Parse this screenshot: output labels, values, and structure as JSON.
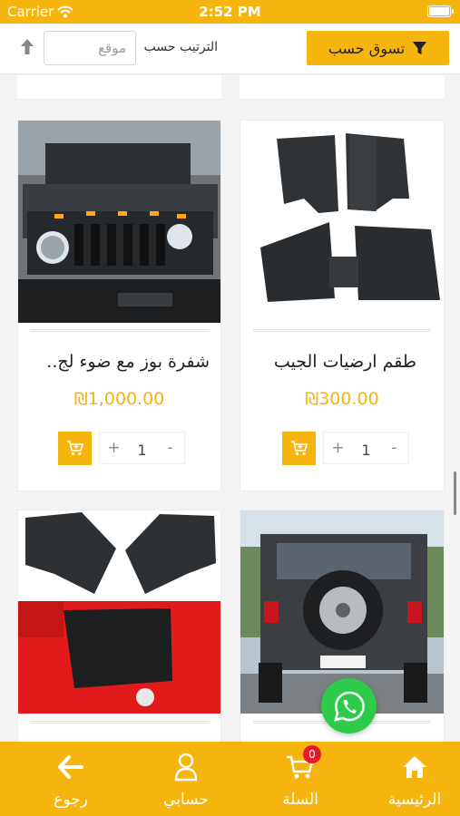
{
  "status_bar": {
    "carrier": "Carrier",
    "time": "2:52 PM"
  },
  "toolbar": {
    "filter_label": "تسوق حسب",
    "sort_label": "الترتيب حسب",
    "sort_placeholder": "موقع"
  },
  "products": [
    {
      "title": "شفرة بوز مع ضوء لج..",
      "price": "₪1,000.00",
      "quantity": "1",
      "plus": "+",
      "minus": "-"
    },
    {
      "title": "طقم ارضيات الجيب",
      "price": "₪300.00",
      "quantity": "1",
      "plus": "+",
      "minus": "-"
    }
  ],
  "bottom_nav": {
    "home": "الرئيسية",
    "cart": "السلة",
    "account": "حسابي",
    "back": "رجوع",
    "cart_count": "0"
  },
  "colors": {
    "accent": "#f6b40e",
    "badge": "#e6182b",
    "whatsapp": "#2ecb4a"
  }
}
